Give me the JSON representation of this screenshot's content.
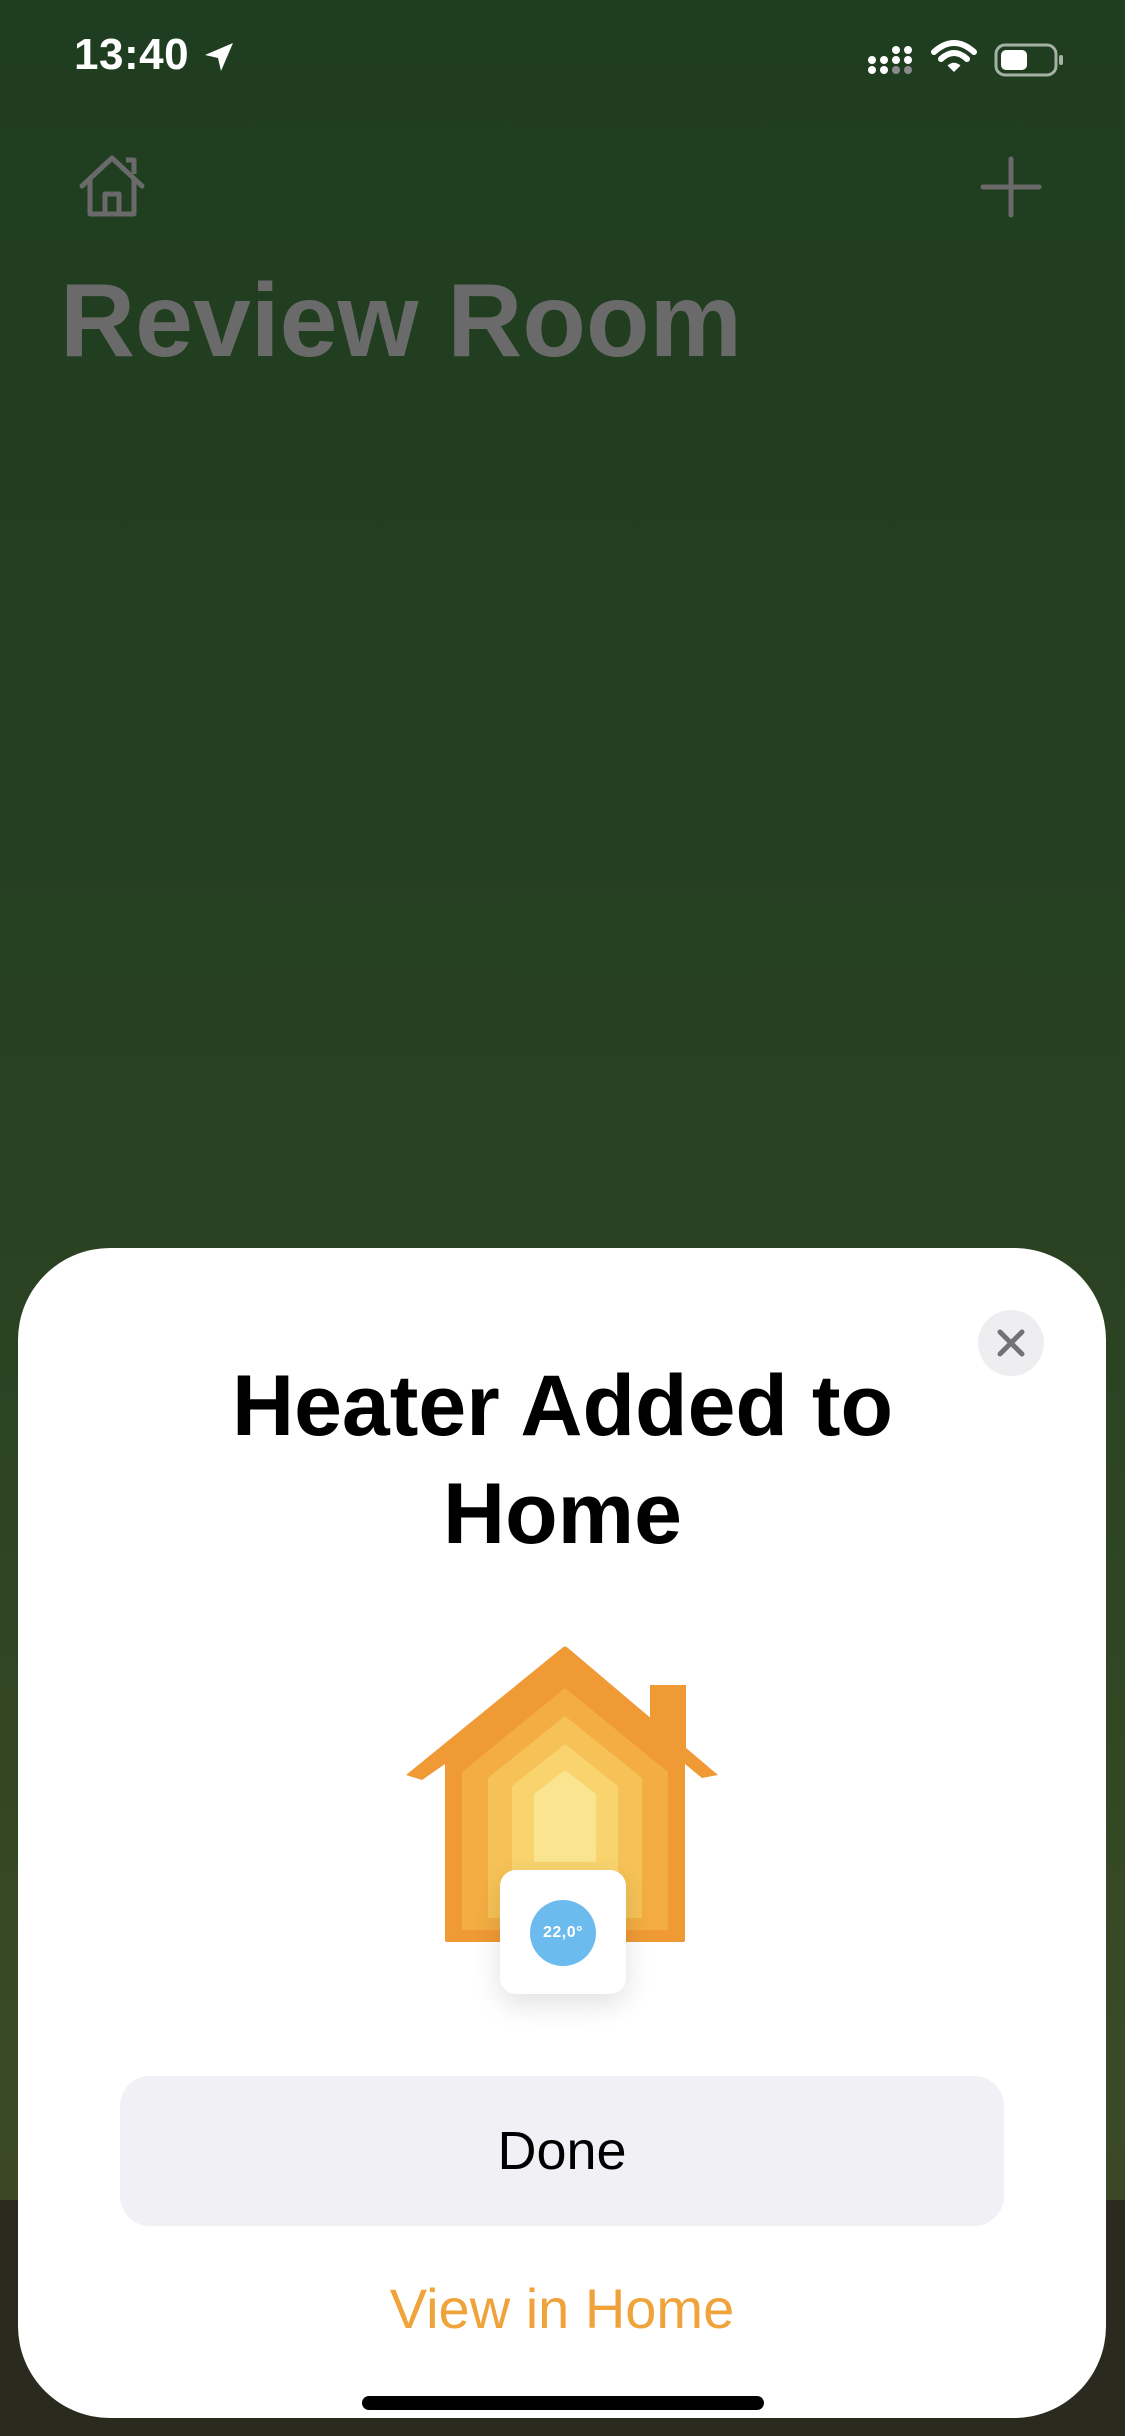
{
  "status_bar": {
    "time": "13:40",
    "icons": [
      "location-arrow-icon",
      "cellular-signal-icon",
      "wifi-icon",
      "battery-icon"
    ]
  },
  "nav": {
    "left_icon": "home-icon",
    "right_icon": "plus-icon"
  },
  "room": {
    "title": "Review Room"
  },
  "sheet": {
    "title": "Heater Added to Home",
    "close_icon": "close-icon",
    "illustration": {
      "icon": "home-house-icon",
      "accessory_temperature": "22,0°"
    },
    "primary_button_label": "Done",
    "secondary_link_label": "View in Home"
  },
  "colors": {
    "accent": "#f0a23b",
    "background_green": "#253f22",
    "sheet_background": "#ffffff",
    "button_background": "#f1f1f5",
    "temperature_badge": "#6cbbee"
  }
}
